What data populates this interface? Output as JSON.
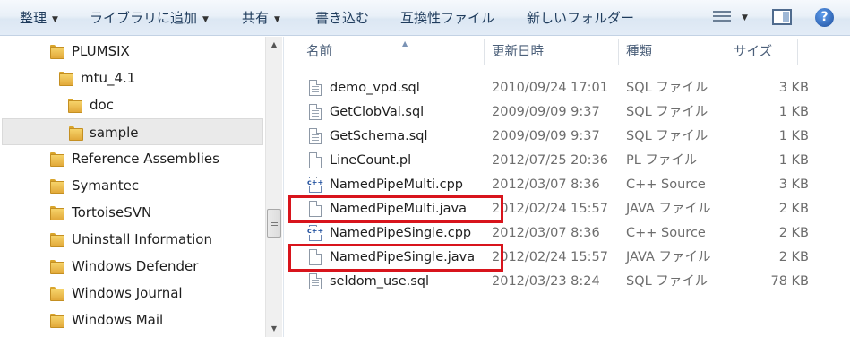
{
  "toolbar": {
    "organize": "整理",
    "library": "ライブラリに追加",
    "share": "共有",
    "burn": "書き込む",
    "compat": "互換性ファイル",
    "new_folder": "新しいフォルダー",
    "help": "?"
  },
  "nav": {
    "items": [
      {
        "label": "PLUMSIX"
      },
      {
        "label": "mtu_4.1"
      },
      {
        "label": "doc"
      },
      {
        "label": "sample"
      },
      {
        "label": "Reference Assemblies"
      },
      {
        "label": "Symantec"
      },
      {
        "label": "TortoiseSVN"
      },
      {
        "label": "Uninstall Information"
      },
      {
        "label": "Windows Defender"
      },
      {
        "label": "Windows Journal"
      },
      {
        "label": "Windows Mail"
      }
    ]
  },
  "columns": {
    "name": "名前",
    "date": "更新日時",
    "type": "種類",
    "size": "サイズ"
  },
  "files": [
    {
      "name": "demo_vpd.sql",
      "date": "2010/09/24 17:01",
      "type": "SQL ファイル",
      "size": "3 KB",
      "icon": "sql-file-icon"
    },
    {
      "name": "GetClobVal.sql",
      "date": "2009/09/09 9:37",
      "type": "SQL ファイル",
      "size": "1 KB",
      "icon": "sql-file-icon"
    },
    {
      "name": "GetSchema.sql",
      "date": "2009/09/09 9:37",
      "type": "SQL ファイル",
      "size": "1 KB",
      "icon": "sql-file-icon"
    },
    {
      "name": "LineCount.pl",
      "date": "2012/07/25 20:36",
      "type": "PL ファイル",
      "size": "1 KB",
      "icon": "file-icon"
    },
    {
      "name": "NamedPipeMulti.cpp",
      "date": "2012/03/07 8:36",
      "type": "C++ Source",
      "size": "3 KB",
      "icon": "cpp-file-icon"
    },
    {
      "name": "NamedPipeMulti.java",
      "date": "2012/02/24 15:57",
      "type": "JAVA ファイル",
      "size": "2 KB",
      "icon": "file-icon"
    },
    {
      "name": "NamedPipeSingle.cpp",
      "date": "2012/03/07 8:36",
      "type": "C++ Source",
      "size": "2 KB",
      "icon": "cpp-file-icon"
    },
    {
      "name": "NamedPipeSingle.java",
      "date": "2012/02/24 15:57",
      "type": "JAVA ファイル",
      "size": "2 KB",
      "icon": "file-icon"
    },
    {
      "name": "seldom_use.sql",
      "date": "2012/03/23 8:24",
      "type": "SQL ファイル",
      "size": "78 KB",
      "icon": "sql-file-icon"
    }
  ],
  "colors": {
    "highlight": "#d8141c",
    "selected_bg": "#eaeaea",
    "header_text": "#4c607a"
  }
}
